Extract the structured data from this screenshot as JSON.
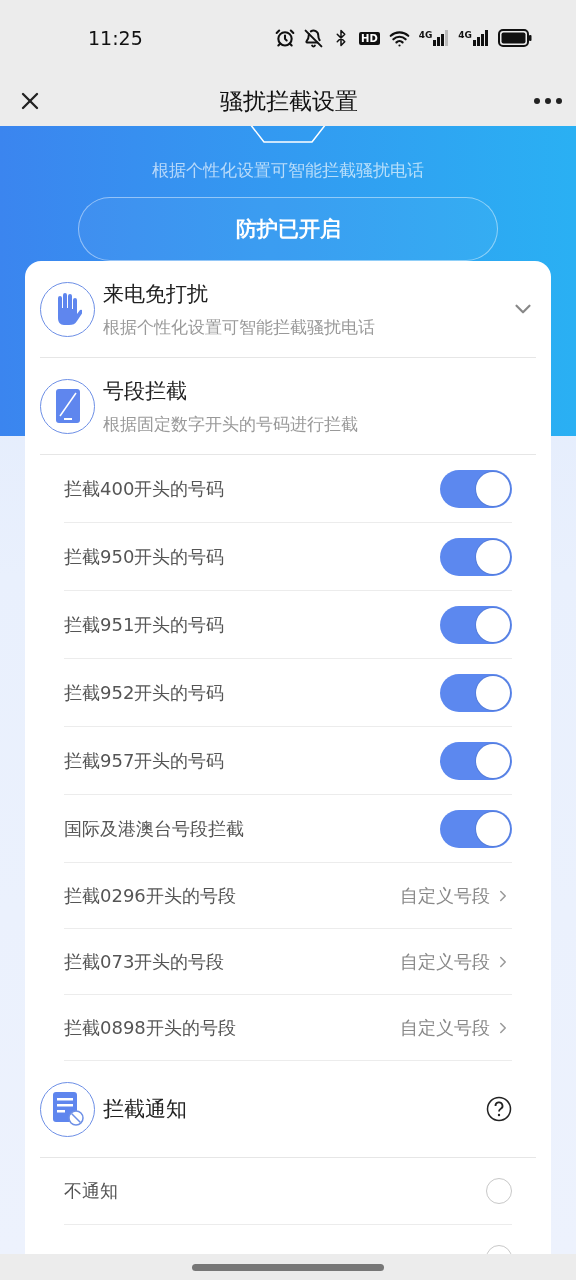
{
  "status_bar": {
    "time": "11:25",
    "hd_label": "HD",
    "networks": [
      {
        "label": "4G"
      },
      {
        "label": "4G"
      }
    ]
  },
  "nav": {
    "title": "骚扰拦截设置"
  },
  "hero": {
    "subtitle": "根据个性化设置可智能拦截骚扰电话",
    "button": "防护已开启"
  },
  "sections": [
    {
      "kind": "collapsible",
      "title": "来电免打扰",
      "subtitle": "根据个性化设置可智能拦截骚扰电话",
      "expanded": false
    },
    {
      "kind": "list",
      "title": "号段拦截",
      "subtitle": "根据固定数字开头的号码进行拦截",
      "rows": [
        {
          "kind": "toggle",
          "label": "拦截400开头的号码",
          "on": true
        },
        {
          "kind": "toggle",
          "label": "拦截950开头的号码",
          "on": true
        },
        {
          "kind": "toggle",
          "label": "拦截951开头的号码",
          "on": true
        },
        {
          "kind": "toggle",
          "label": "拦截952开头的号码",
          "on": true
        },
        {
          "kind": "toggle",
          "label": "拦截957开头的号码",
          "on": true
        },
        {
          "kind": "toggle",
          "label": "国际及港澳台号段拦截",
          "on": true
        },
        {
          "kind": "link",
          "label": "拦截0296开头的号段",
          "action": "自定义号段"
        },
        {
          "kind": "link",
          "label": "拦截073开头的号段",
          "action": "自定义号段"
        },
        {
          "kind": "link",
          "label": "拦截0898开头的号段",
          "action": "自定义号段"
        }
      ]
    },
    {
      "kind": "help",
      "title": "拦截通知",
      "rows": [
        {
          "kind": "radio",
          "label": "不通知",
          "selected": false
        },
        {
          "kind": "radio",
          "selected": false
        }
      ]
    }
  ]
}
